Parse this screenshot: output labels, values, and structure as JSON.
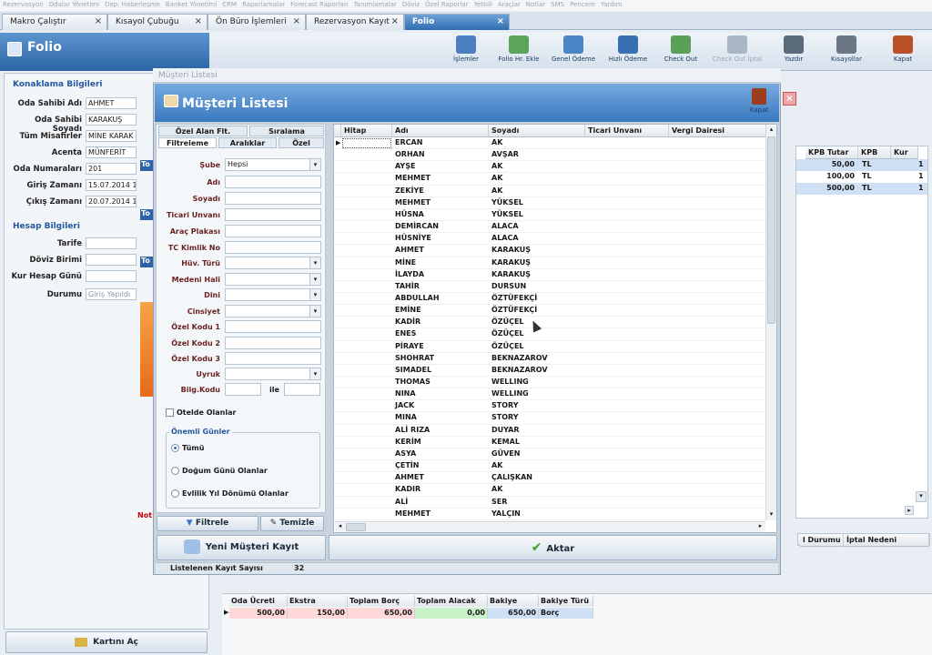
{
  "menu": [
    "Rezervasyon",
    "Odalar Yönetimi",
    "Dep. Haberleşme",
    "Banket Yönetimi",
    "CRM",
    "Raporlamalar",
    "Forecast Raporları",
    "Tanımlamalar",
    "Döviz",
    "Özel Raporlar",
    "Yetkili",
    "Araçlar",
    "Notlar",
    "SMS",
    "Pencere",
    "Yardım"
  ],
  "tabs": [
    {
      "label": "Makro Çalıştır"
    },
    {
      "label": "Kısayol Çubuğu"
    },
    {
      "label": "Ön Büro İşlemleri"
    },
    {
      "label": "Rezervasyon Kayıt"
    },
    {
      "label": "Folio"
    }
  ],
  "folio": {
    "title": "Folio",
    "toolbar": [
      "İşlemler",
      "Folio Hr. Ekle",
      "Genel Ödeme",
      "Hızlı Ödeme",
      "Check Out",
      "Check Out İptal",
      "Yazdır",
      "Kısayollar",
      "Kapat"
    ],
    "stay_group": "Konaklama Bilgileri",
    "fields": [
      {
        "label": "Oda Sahibi Adı",
        "value": "AHMET"
      },
      {
        "label": "Oda Sahibi Soyadı",
        "value": "KARAKUŞ"
      },
      {
        "label": "Tüm Misafirler",
        "value": "MİNE KARAK"
      },
      {
        "label": "Acenta",
        "value": "MÜNFERİT"
      },
      {
        "label": "Oda Numaraları",
        "value": "201"
      },
      {
        "label": "Giriş Zamanı",
        "value": "15.07.2014 1"
      },
      {
        "label": "Çıkış Zamanı",
        "value": "20.07.2014 1"
      }
    ],
    "account_group": "Hesap Bilgileri",
    "account_fields": [
      {
        "label": "Tarife",
        "value": ""
      },
      {
        "label": "Döviz Birimi",
        "value": ""
      },
      {
        "label": "Kur Hesap Günü",
        "value": ""
      },
      {
        "label": "Durumu",
        "value": "Giriş Yapıldı"
      }
    ],
    "card_button": "Kartını Aç",
    "note": "Not:",
    "side_tags": [
      "To",
      "To",
      "To"
    ],
    "right_table": {
      "headers": [
        "KPB Tutar",
        "KPB",
        "Kur"
      ],
      "rows": [
        [
          "50,00",
          "TL",
          "1"
        ],
        [
          "100,00",
          "TL",
          "1"
        ],
        [
          "500,00",
          "TL",
          "1"
        ]
      ]
    },
    "right_bottom_headers": [
      "l Durumu",
      "İptal Nedeni"
    ],
    "totals": {
      "headers": [
        "Oda Ücreti",
        "Ekstra",
        "Toplam Borç",
        "Toplam Alacak",
        "Bakiye",
        "Bakiye Türü"
      ],
      "values": [
        "500,00",
        "150,00",
        "650,00",
        "0,00",
        "650,00",
        "Borç"
      ]
    }
  },
  "dialog": {
    "caption": "Müşteri Listesi",
    "title": "Müşteri Listesi",
    "close_label": "Kapat",
    "tabs_top": [
      "Özel Alan Flt.",
      "Sıralama"
    ],
    "tabs_bottom": [
      "Filtreleme",
      "Aralıklar",
      "Özel"
    ],
    "filters": [
      {
        "label": "Şube",
        "value": "Hepsi",
        "dropdown": true
      },
      {
        "label": "Adı",
        "value": ""
      },
      {
        "label": "Soyadı",
        "value": ""
      },
      {
        "label": "Ticari Unvanı",
        "value": ""
      },
      {
        "label": "Araç Plakası",
        "value": ""
      },
      {
        "label": "TC Kimlik No",
        "value": ""
      },
      {
        "label": "Hüv. Türü",
        "value": "",
        "dropdown": true
      },
      {
        "label": "Medeni Hali",
        "value": "",
        "dropdown": true
      },
      {
        "label": "Dini",
        "value": "",
        "dropdown": true
      },
      {
        "label": "Cinsiyet",
        "value": "",
        "dropdown": true
      },
      {
        "label": "Özel Kodu 1",
        "value": ""
      },
      {
        "label": "Özel Kodu 2",
        "value": ""
      },
      {
        "label": "Özel Kodu 3",
        "value": ""
      },
      {
        "label": "Uyruk",
        "value": "",
        "dropdown": true
      }
    ],
    "bilg_label": "Bilg.Kodu",
    "bilg_sep": "ile",
    "otelde": "Otelde Olanlar",
    "important_days": "Önemli Günler",
    "radios": [
      "Tümü",
      "Doğum Günü Olanlar",
      "Evlilik Yıl Dönümü Olanlar"
    ],
    "filter_btn": "Filtrele",
    "clear_btn": "Temizle",
    "new_btn": "Yeni Müşteri Kayıt",
    "transfer_btn": "Aktar",
    "count_label": "Listelenen Kayıt Sayısı",
    "count_value": "32",
    "columns": [
      "Hitap",
      "Adı",
      "Soyadı",
      "Ticari Unvanı",
      "Vergi Dairesi"
    ],
    "customers": [
      [
        "ERCAN",
        "AK"
      ],
      [
        "ORHAN",
        "AVŞAR"
      ],
      [
        "AYŞE",
        "AK"
      ],
      [
        "MEHMET",
        "AK"
      ],
      [
        "ZEKİYE",
        "AK"
      ],
      [
        "MEHMET",
        "YÜKSEL"
      ],
      [
        "HÜSNA",
        "YÜKSEL"
      ],
      [
        "DEMİRCAN",
        "ALACA"
      ],
      [
        "HÜSNİYE",
        "ALACA"
      ],
      [
        "AHMET",
        "KARAKUŞ"
      ],
      [
        "MİNE",
        "KARAKUŞ"
      ],
      [
        "İLAYDA",
        "KARAKUŞ"
      ],
      [
        "TAHİR",
        "DURSUN"
      ],
      [
        "ABDULLAH",
        "ÖZTÜFEKÇİ"
      ],
      [
        "EMİNE",
        "ÖZTÜFEKÇİ"
      ],
      [
        "KADİR",
        "ÖZÜÇEL"
      ],
      [
        "ENES",
        "ÖZÜÇEL"
      ],
      [
        "PİRAYE",
        "ÖZÜÇEL"
      ],
      [
        "SHOHRAT",
        "BEKNAZAROV"
      ],
      [
        "SIMADEL",
        "BEKNAZAROV"
      ],
      [
        "THOMAS",
        "WELLING"
      ],
      [
        "NINA",
        "WELLING"
      ],
      [
        "JACK",
        "STORY"
      ],
      [
        "MINA",
        "STORY"
      ],
      [
        "ALİ RIZA",
        "DUYAR"
      ],
      [
        "KERİM",
        "KEMAL"
      ],
      [
        "ASYA",
        "GÜVEN"
      ],
      [
        "ÇETİN",
        "AK"
      ],
      [
        "AHMET",
        "ÇALIŞKAN"
      ],
      [
        "KADIR",
        "AK"
      ],
      [
        "ALİ",
        "SER"
      ],
      [
        "MEHMET",
        "YALÇIN"
      ]
    ]
  }
}
